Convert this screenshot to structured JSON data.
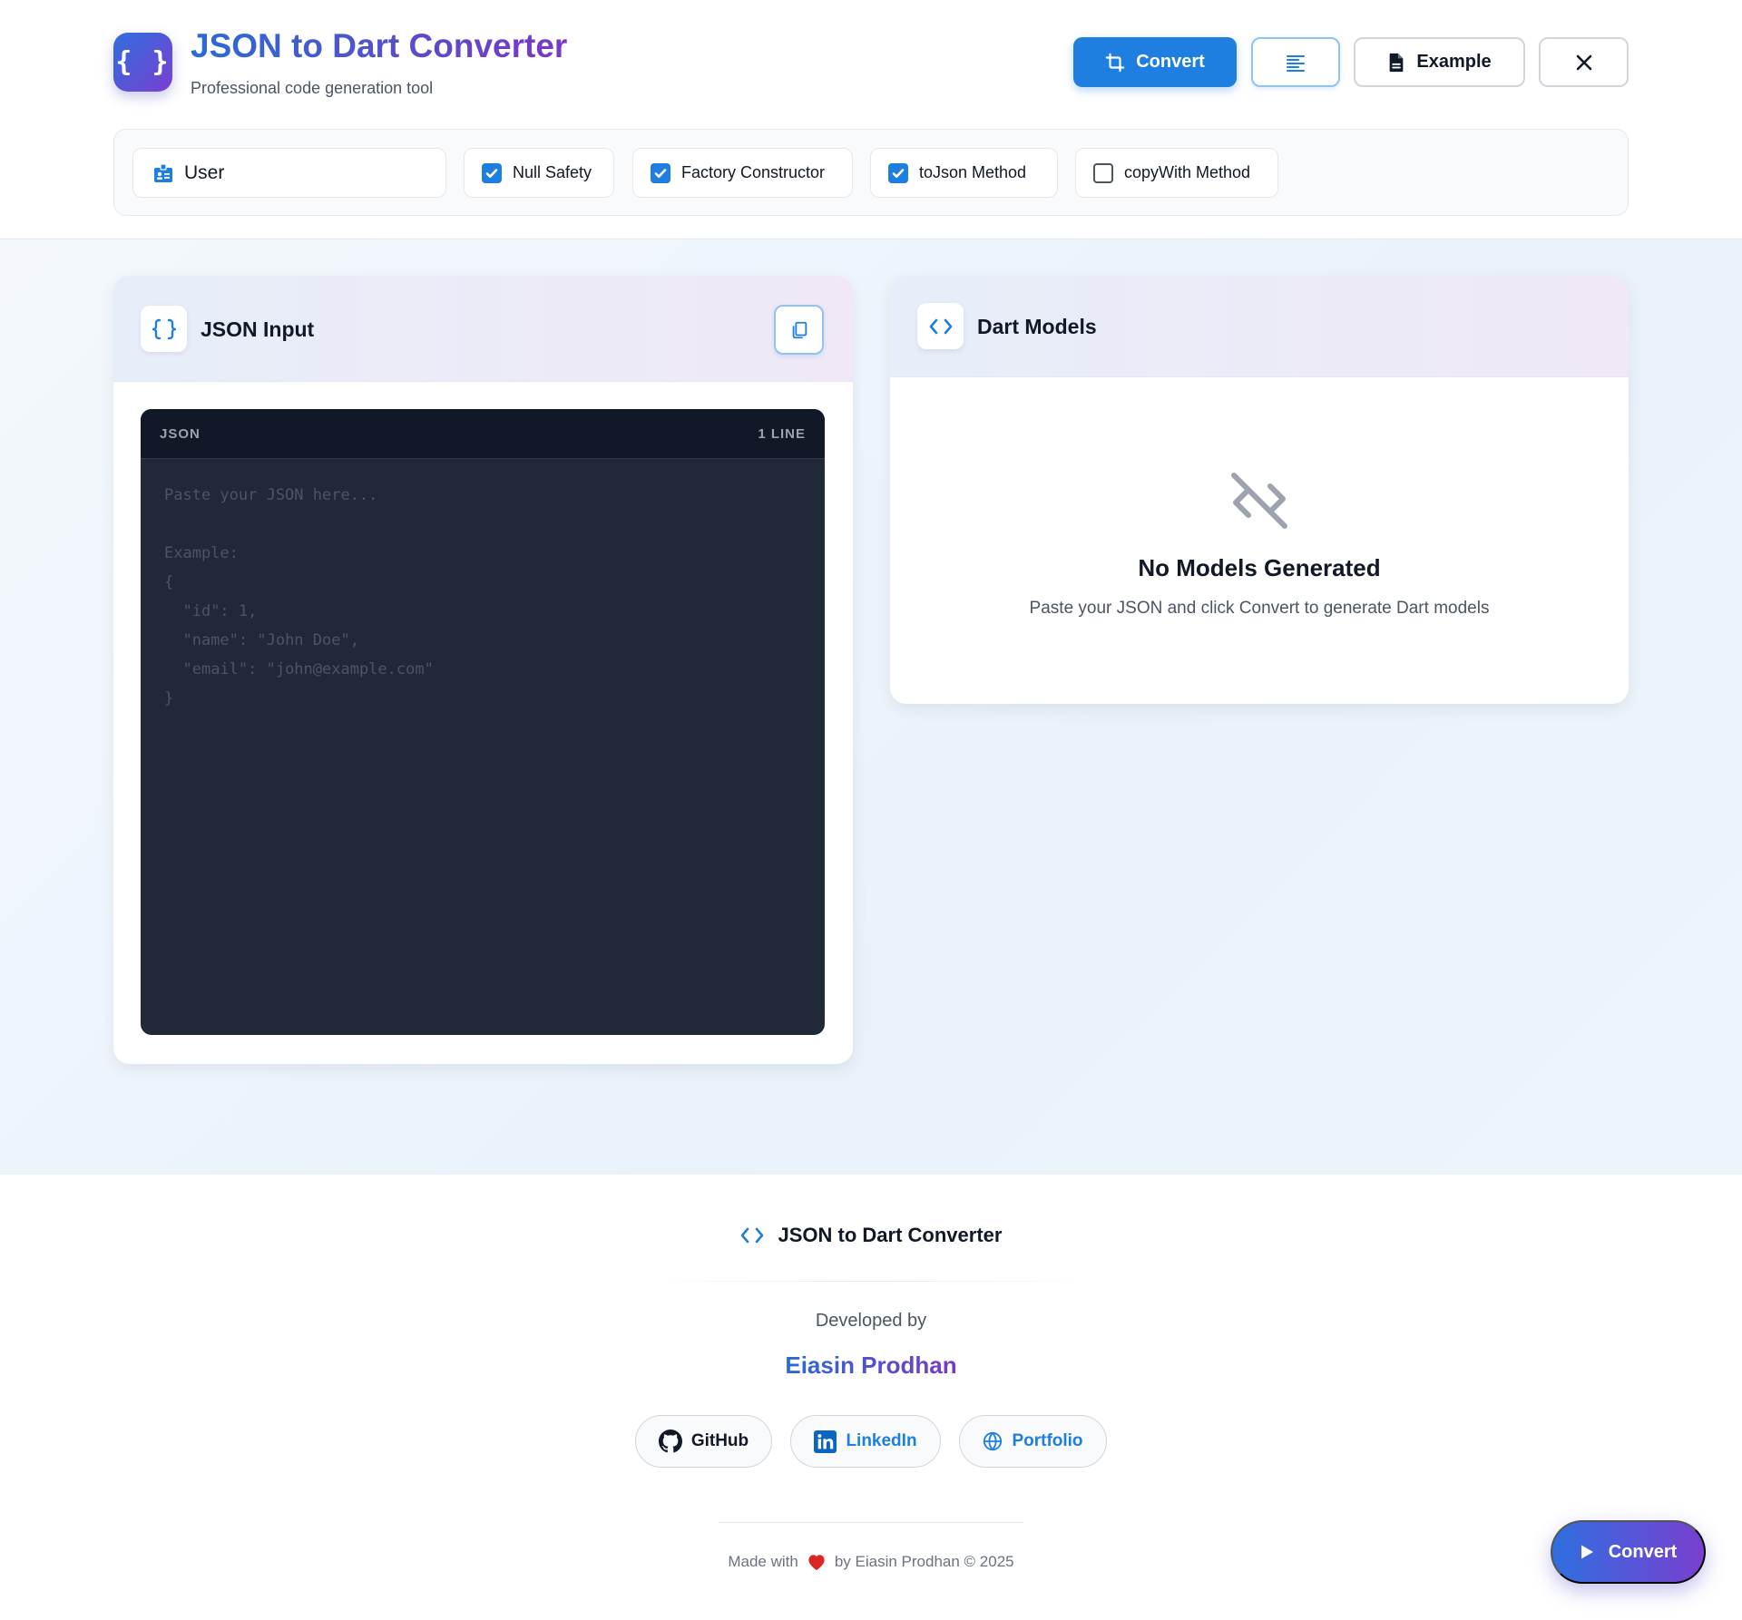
{
  "header": {
    "logo_text": "{ }",
    "title": "JSON to Dart Converter",
    "subtitle": "Professional code generation tool",
    "buttons": {
      "convert_label": "Convert",
      "format_icon": "align-left-icon",
      "example_label": "Example",
      "clear_icon": "close-icon"
    }
  },
  "options": {
    "class_name": {
      "value": "User",
      "icon": "id-badge-icon"
    },
    "checkboxes": [
      {
        "label": "Null Safety",
        "checked": true
      },
      {
        "label": "Factory Constructor",
        "checked": true
      },
      {
        "label": "toJson Method",
        "checked": true
      },
      {
        "label": "copyWith Method",
        "checked": false
      }
    ]
  },
  "input_panel": {
    "title": "JSON Input",
    "icon": "braces-icon",
    "copy_icon": "copy-icon",
    "editor": {
      "language": "JSON",
      "line_count": "1 LINE",
      "value": "",
      "placeholder": "Paste your JSON here...\n\nExample:\n{\n  \"id\": 1,\n  \"name\": \"John Doe\",\n  \"email\": \"john@example.com\"\n}"
    }
  },
  "output_panel": {
    "title": "Dart Models",
    "icon": "code-icon",
    "empty_state": {
      "icon": "code-off-icon",
      "title": "No Models Generated",
      "text": "Paste your JSON and click Convert to generate Dart models"
    }
  },
  "footer": {
    "brand": "JSON to Dart Converter",
    "developed_by": "Developed by",
    "developer": "Eiasin Prodhan",
    "links": [
      {
        "label": "GitHub",
        "icon": "github-icon"
      },
      {
        "label": "LinkedIn",
        "icon": "linkedin-icon"
      },
      {
        "label": "Portfolio",
        "icon": "globe-icon"
      }
    ],
    "made_with_prefix": "Made with",
    "made_with_suffix": "by Eiasin Prodhan © 2025"
  },
  "fab": {
    "label": "Convert",
    "icon": "play-icon"
  },
  "colors": {
    "primary": "#1e7fe0",
    "gradient_start": "#2f6fe0",
    "gradient_end": "#7a3fcf",
    "editor_bg": "#1f2937",
    "heart": "#dc2626"
  }
}
